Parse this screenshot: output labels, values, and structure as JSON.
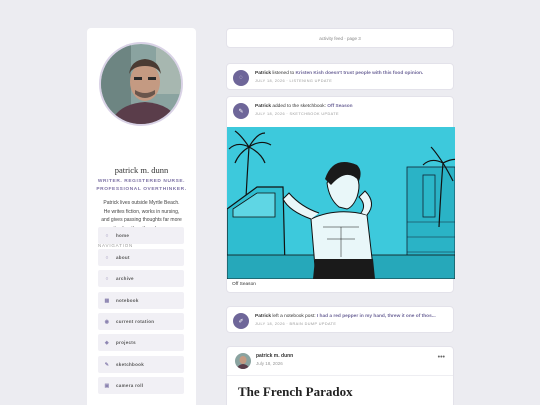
{
  "profile": {
    "name": "patrick m. dunn",
    "tagline_line1": "WRITER. REGISTERED NURSE.",
    "tagline_line2": "PROFESSIONAL OVERTHINKER.",
    "bio_line1": "Patrick lives outside Myrtle Beach.",
    "bio_line2": "He writes fiction, works in nursing,",
    "bio_line3": "and gives passing thoughts far more",
    "bio_line4": "attention than they deserve."
  },
  "nav": {
    "title": "NAVIGATION",
    "items": [
      {
        "label": "home",
        "icon": "○"
      },
      {
        "label": "about",
        "icon": "○"
      },
      {
        "label": "archive",
        "icon": "○"
      },
      {
        "label": "notebook",
        "icon": "▦"
      },
      {
        "label": "current rotation",
        "icon": "◉"
      },
      {
        "label": "projects",
        "icon": "◈"
      },
      {
        "label": "sketchbook",
        "icon": "✎"
      },
      {
        "label": "camera roll",
        "icon": "▣"
      }
    ]
  },
  "feed": {
    "header": "activity feed · page 3",
    "activity1": {
      "actor": "Patrick",
      "verb": " listened to ",
      "link": "Kristen Kish doesn't trust people with this food opinion.",
      "meta": "JULY 18, 2026 · LISTENING UPDATE"
    },
    "activity2": {
      "actor": "Patrick",
      "verb": " added to the sketchbook: ",
      "link": "Off Season",
      "meta": "JULY 18, 2026 · SKETCHBOOK UPDATE",
      "caption": "Off Season"
    },
    "activity3": {
      "actor": "Patrick",
      "verb": " left a notebook post: ",
      "link": "I had a red pepper in my hand, threw it one of thos...",
      "meta": "JULY 18, 2026 · BRAIN DUMP UPDATE"
    },
    "post": {
      "author": "patrick m. dunn",
      "date": "July 18, 2026",
      "more": "•••",
      "title": "The French Paradox"
    }
  },
  "colors": {
    "accent": "#6e6699",
    "art_bg": "#3dc9dc",
    "page_bg": "#ececf1"
  }
}
